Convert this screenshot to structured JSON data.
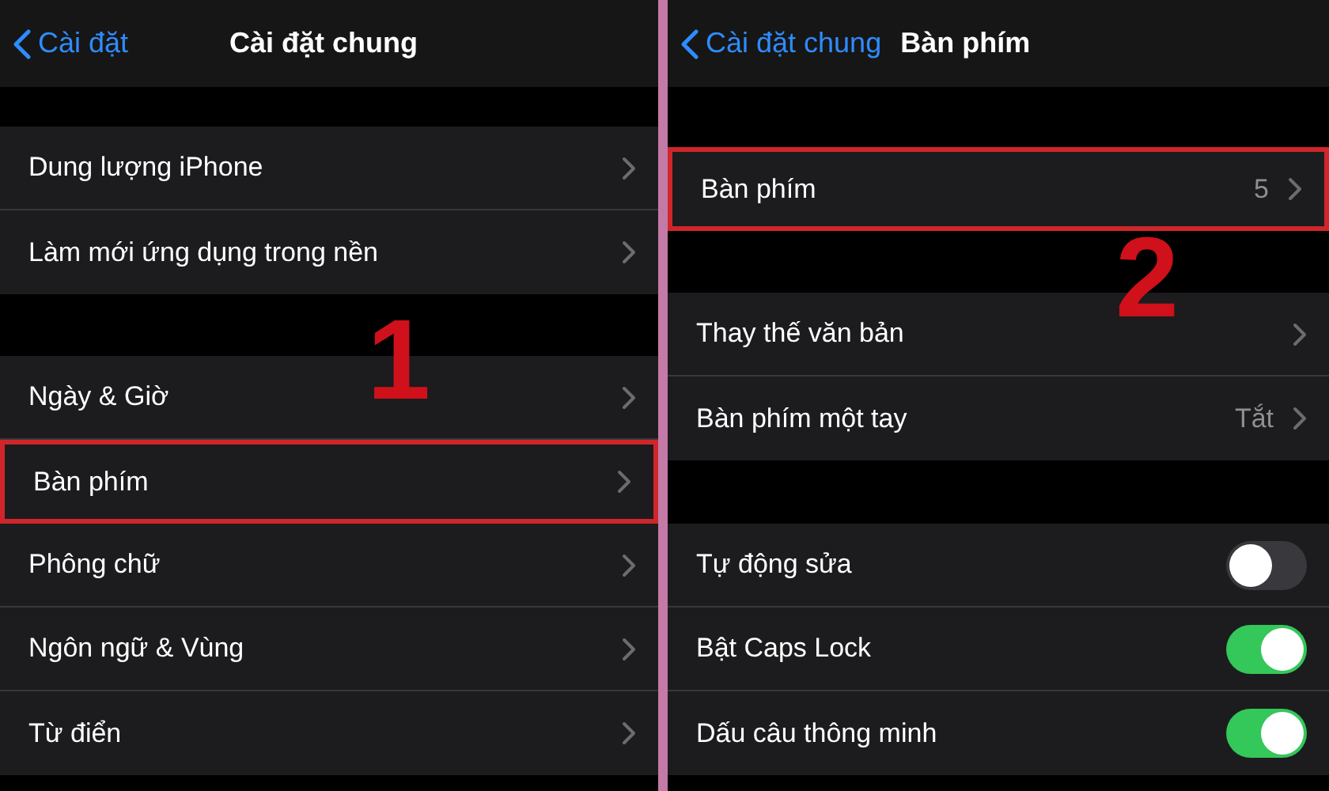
{
  "panels": [
    {
      "back_label": "Cài đặt",
      "title": "Cài đặt chung",
      "callout": "1",
      "groups": [
        {
          "rows": [
            {
              "kind": "link",
              "label": "Dung lượng iPhone",
              "highlighted": false
            },
            {
              "kind": "link",
              "label": "Làm mới ứng dụng trong nền",
              "highlighted": false
            }
          ]
        },
        {
          "rows": [
            {
              "kind": "link",
              "label": "Ngày & Giờ",
              "highlighted": false
            },
            {
              "kind": "link",
              "label": "Bàn phím",
              "highlighted": true
            },
            {
              "kind": "link",
              "label": "Phông chữ",
              "highlighted": false
            },
            {
              "kind": "link",
              "label": "Ngôn ngữ & Vùng",
              "highlighted": false
            },
            {
              "kind": "link",
              "label": "Từ điển",
              "highlighted": false
            }
          ]
        }
      ]
    },
    {
      "back_label": "Cài đặt chung",
      "title": "Bàn phím",
      "callout": "2",
      "groups": [
        {
          "rows": [
            {
              "kind": "link",
              "label": "Bàn phím",
              "value": "5",
              "highlighted": true
            }
          ]
        },
        {
          "rows": [
            {
              "kind": "link",
              "label": "Thay thế văn bản",
              "highlighted": false
            },
            {
              "kind": "link",
              "label": "Bàn phím một tay",
              "value": "Tắt",
              "highlighted": false
            }
          ]
        },
        {
          "rows": [
            {
              "kind": "toggle",
              "label": "Tự động sửa",
              "on": false,
              "highlighted": false
            },
            {
              "kind": "toggle",
              "label": "Bật Caps Lock",
              "on": true,
              "highlighted": false
            },
            {
              "kind": "toggle",
              "label": "Dấu câu thông minh",
              "on": true,
              "highlighted": false
            }
          ]
        }
      ]
    }
  ]
}
